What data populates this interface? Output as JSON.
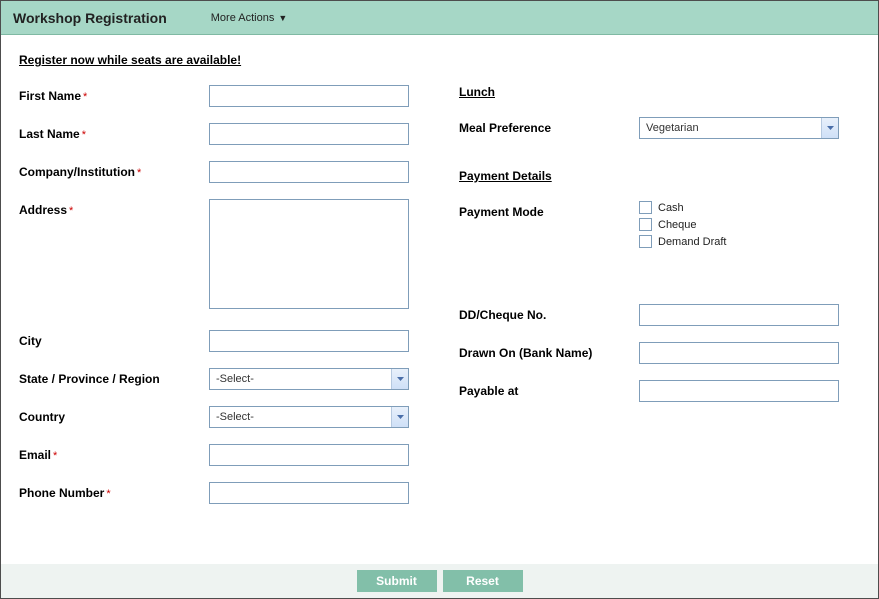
{
  "header": {
    "title": "Workshop Registration",
    "more_actions": "More Actions"
  },
  "heading_link": "Register now while seats are available!",
  "left": {
    "first_name": {
      "label": "First Name",
      "value": "",
      "required": true
    },
    "last_name": {
      "label": "Last Name",
      "value": "",
      "required": true
    },
    "company": {
      "label": "Company/Institution",
      "value": "",
      "required": true
    },
    "address": {
      "label": "Address",
      "value": "",
      "required": true
    },
    "city": {
      "label": "City",
      "value": "",
      "required": false
    },
    "state": {
      "label": "State / Province / Region",
      "value": "-Select-"
    },
    "country": {
      "label": "Country",
      "value": "-Select-"
    },
    "email": {
      "label": "Email",
      "value": "",
      "required": true
    },
    "phone": {
      "label": "Phone Number",
      "value": "",
      "required": true
    }
  },
  "right": {
    "lunch_head": "Lunch",
    "meal": {
      "label": "Meal Preference",
      "value": "Vegetarian"
    },
    "payment_head": "Payment Details",
    "payment_mode": {
      "label": "Payment Mode",
      "options": {
        "cash": "Cash",
        "cheque": "Cheque",
        "dd": "Demand Draft"
      }
    },
    "dd_no": {
      "label": "DD/Cheque No.",
      "value": ""
    },
    "drawn_on": {
      "label": "Drawn On (Bank Name)",
      "value": ""
    },
    "payable_at": {
      "label": "Payable at",
      "value": ""
    }
  },
  "footer": {
    "submit": "Submit",
    "reset": "Reset"
  },
  "required_marker": "*"
}
